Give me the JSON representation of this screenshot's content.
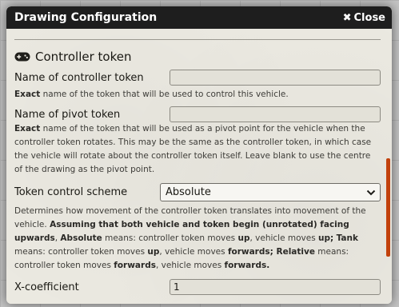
{
  "header": {
    "title": "Drawing Configuration",
    "close_label": "Close"
  },
  "section": {
    "title": "Controller token",
    "icon": "gamepad-icon"
  },
  "fields": {
    "controller": {
      "label": "Name of controller token",
      "value": "",
      "hint_strong": "Exact",
      "hint_rest": " name of the token that will be used to control this vehicle."
    },
    "pivot": {
      "label": "Name of pivot token",
      "value": "",
      "hint_strong": "Exact",
      "hint_rest": " name of the token that will be used as a pivot point for the vehicle when the controller token rotates. This may be the same as the controller token, in which case the vehicle will rotate about the controller token itself. Leave blank to use the centre of the drawing as the pivot point."
    },
    "scheme": {
      "label": "Token control scheme",
      "selected": "Absolute",
      "hint": [
        {
          "t": "Determines how movement of the controller token translates into movement of the vehicle. ",
          "b": false
        },
        {
          "t": "Assuming that both vehicle and token begin (unrotated) facing upwards",
          "b": true
        },
        {
          "t": ", ",
          "b": false
        },
        {
          "t": "Absolute",
          "b": true
        },
        {
          "t": " means: controller token moves ",
          "b": false
        },
        {
          "t": "up",
          "b": true
        },
        {
          "t": ", vehicle moves ",
          "b": false
        },
        {
          "t": "up;",
          "b": true
        },
        {
          "t": " ",
          "b": false
        },
        {
          "t": "Tank",
          "b": true
        },
        {
          "t": " means: controller token moves ",
          "b": false
        },
        {
          "t": "up",
          "b": true
        },
        {
          "t": ", vehicle moves ",
          "b": false
        },
        {
          "t": "forwards; Relative",
          "b": true
        },
        {
          "t": " means: controller token moves ",
          "b": false
        },
        {
          "t": "forwards",
          "b": true
        },
        {
          "t": ", vehicle moves ",
          "b": false
        },
        {
          "t": "forwards.",
          "b": true
        }
      ]
    },
    "xcoef": {
      "label": "X-coefficient",
      "value": "1"
    }
  },
  "colors": {
    "header_bg": "#1e1e1e",
    "scrollbar": "#c2410c",
    "panel_bg": "#ebe9e1"
  }
}
